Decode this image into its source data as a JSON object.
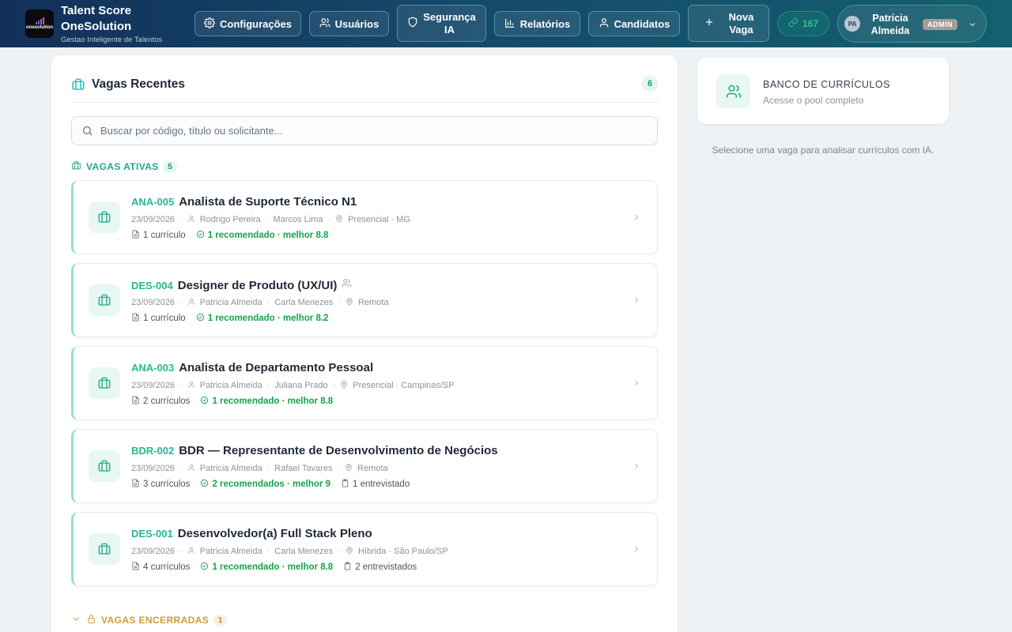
{
  "brand": {
    "logo_text": "onesolution",
    "title": "Talent Score OneSolution",
    "subtitle": "Gestao Inteligente de Talentos"
  },
  "nav": {
    "config": "Configurações",
    "users": "Usuários",
    "security_line1": "Segurança",
    "security_line2": "IA",
    "reports": "Relatórios",
    "candidates": "Candidatos",
    "new_job_line1": "Nova",
    "new_job_line2": "Vaga",
    "credits": "167"
  },
  "user": {
    "initials": "PA",
    "first_name": "Patricia",
    "last_name": "Almeida",
    "role": "ADMIN"
  },
  "panel": {
    "title": "Vagas Recentes",
    "count": "6",
    "search_placeholder": "Buscar por código, título ou solicitante...",
    "active_label": "VAGAS ATIVAS",
    "active_count": "5",
    "closed_label": "VAGAS ENCERRADAS",
    "closed_count": "1"
  },
  "jobs": [
    {
      "code": "ANA-005",
      "title": "Analista de Suporte Técnico N1",
      "date": "23/09/2026",
      "requester": "Rodrigo Pereira",
      "recruiter": "Marcos Lima",
      "location": "Presencial · MG",
      "cvs": "1 currículo",
      "recommended": "1 recomendado · melhor 8.8",
      "interviews": ""
    },
    {
      "code": "DES-004",
      "title": "Designer de Produto (UX/UI)",
      "date": "23/09/2026",
      "requester": "Patricia Almeida",
      "recruiter": "Carla Menezes",
      "location": "Remota",
      "cvs": "1 currículo",
      "recommended": "1 recomendado · melhor 8.2",
      "interviews": ""
    },
    {
      "code": "ANA-003",
      "title": "Analista de Departamento Pessoal",
      "date": "23/09/2026",
      "requester": "Patricia Almeida",
      "recruiter": "Juliana Prado",
      "location": "Presencial · Campinas/SP",
      "cvs": "2 currículos",
      "recommended": "1 recomendado · melhor 8.8",
      "interviews": ""
    },
    {
      "code": "BDR-002",
      "title": "BDR — Representante de Desenvolvimento de Negócios",
      "date": "23/09/2026",
      "requester": "Patricia Almeida",
      "recruiter": "Rafael Tavares",
      "location": "Remota",
      "cvs": "3 currículos",
      "recommended": "2 recomendados · melhor 9",
      "interviews": "1 entrevistado"
    },
    {
      "code": "DES-001",
      "title": "Desenvolvedor(a) Full Stack Pleno",
      "date": "23/09/2026",
      "requester": "Patricia Almeida",
      "recruiter": "Carla Menezes",
      "location": "Híbrida · São Paulo/SP",
      "cvs": "4 currículos",
      "recommended": "1 recomendado · melhor 8.8",
      "interviews": "2 entrevistados"
    }
  ],
  "bank": {
    "title": "BANCO DE CURRÍCULOS",
    "subtitle": "Acesse o pool completo"
  },
  "hint": "Selecione uma vaga para analisar currículos com IA."
}
